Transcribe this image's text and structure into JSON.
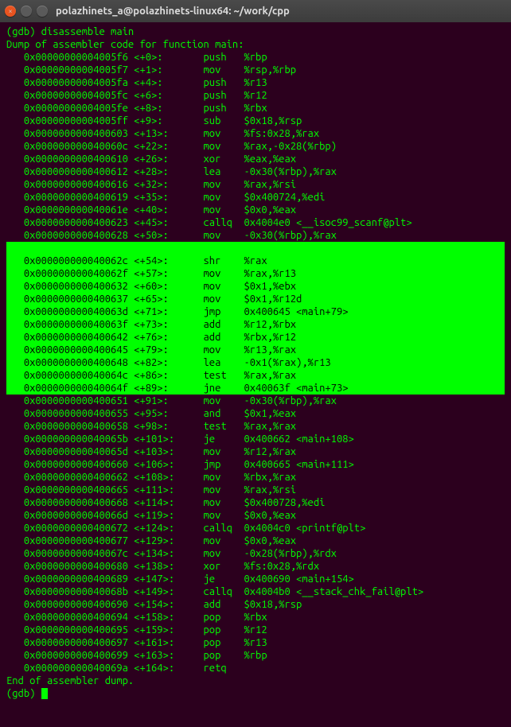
{
  "titlebar": {
    "title": "polazhinets_a@polazhinets-linux64: ~/work/cpp"
  },
  "term": {
    "prompt_cmd": "(gdb) disassemble main",
    "dump_header": "Dump of assembler code for function main:",
    "lines": [
      {
        "hl": false,
        "addr": "0x00000000004005f6",
        "off": "<+0>:",
        "mn": "push",
        "ops": "%rbp"
      },
      {
        "hl": false,
        "addr": "0x00000000004005f7",
        "off": "<+1>:",
        "mn": "mov",
        "ops": "%rsp,%rbp"
      },
      {
        "hl": false,
        "addr": "0x00000000004005fa",
        "off": "<+4>:",
        "mn": "push",
        "ops": "%r13"
      },
      {
        "hl": false,
        "addr": "0x00000000004005fc",
        "off": "<+6>:",
        "mn": "push",
        "ops": "%r12"
      },
      {
        "hl": false,
        "addr": "0x00000000004005fe",
        "off": "<+8>:",
        "mn": "push",
        "ops": "%rbx"
      },
      {
        "hl": false,
        "addr": "0x00000000004005ff",
        "off": "<+9>:",
        "mn": "sub",
        "ops": "$0x18,%rsp"
      },
      {
        "hl": false,
        "addr": "0x0000000000400603",
        "off": "<+13>:",
        "mn": "mov",
        "ops": "%fs:0x28,%rax"
      },
      {
        "hl": false,
        "addr": "0x000000000040060c",
        "off": "<+22>:",
        "mn": "mov",
        "ops": "%rax,-0x28(%rbp)"
      },
      {
        "hl": false,
        "addr": "0x0000000000400610",
        "off": "<+26>:",
        "mn": "xor",
        "ops": "%eax,%eax"
      },
      {
        "hl": false,
        "addr": "0x0000000000400612",
        "off": "<+28>:",
        "mn": "lea",
        "ops": "-0x30(%rbp),%rax"
      },
      {
        "hl": false,
        "addr": "0x0000000000400616",
        "off": "<+32>:",
        "mn": "mov",
        "ops": "%rax,%rsi"
      },
      {
        "hl": false,
        "addr": "0x0000000000400619",
        "off": "<+35>:",
        "mn": "mov",
        "ops": "$0x400724,%edi"
      },
      {
        "hl": false,
        "addr": "0x000000000040061e",
        "off": "<+40>:",
        "mn": "mov",
        "ops": "$0x0,%eax"
      },
      {
        "hl": false,
        "addr": "0x0000000000400623",
        "off": "<+45>:",
        "mn": "callq",
        "ops": "0x4004e0 <__isoc99_scanf@plt>"
      },
      {
        "hl": false,
        "addr": "0x0000000000400628",
        "off": "<+50>:",
        "mn": "mov",
        "ops": "-0x30(%rbp),%rax"
      },
      {
        "hl": true,
        "addr": "0x000000000040062c",
        "off": "<+54>:",
        "mn": "shr",
        "ops": "%rax",
        "pad": true
      },
      {
        "hl": true,
        "addr": "0x000000000040062f",
        "off": "<+57>:",
        "mn": "mov",
        "ops": "%rax,%r13"
      },
      {
        "hl": true,
        "addr": "0x0000000000400632",
        "off": "<+60>:",
        "mn": "mov",
        "ops": "$0x1,%ebx"
      },
      {
        "hl": true,
        "addr": "0x0000000000400637",
        "off": "<+65>:",
        "mn": "mov",
        "ops": "$0x1,%r12d"
      },
      {
        "hl": true,
        "addr": "0x000000000040063d",
        "off": "<+71>:",
        "mn": "jmp",
        "ops": "0x400645 <main+79>"
      },
      {
        "hl": true,
        "addr": "0x000000000040063f",
        "off": "<+73>:",
        "mn": "add",
        "ops": "%r12,%rbx"
      },
      {
        "hl": true,
        "addr": "0x0000000000400642",
        "off": "<+76>:",
        "mn": "add",
        "ops": "%rbx,%r12"
      },
      {
        "hl": true,
        "addr": "0x0000000000400645",
        "off": "<+79>:",
        "mn": "mov",
        "ops": "%r13,%rax"
      },
      {
        "hl": true,
        "addr": "0x0000000000400648",
        "off": "<+82>:",
        "mn": "lea",
        "ops": "-0x1(%rax),%r13"
      },
      {
        "hl": true,
        "addr": "0x000000000040064c",
        "off": "<+86>:",
        "mn": "test",
        "ops": "%rax,%rax"
      },
      {
        "hl": true,
        "addr": "0x000000000040064f",
        "off": "<+89>:",
        "mn": "jne",
        "ops": "0x40063f <main+73>"
      },
      {
        "hl": false,
        "addr": "0x0000000000400651",
        "off": "<+91>:",
        "mn": "mov",
        "ops": "-0x30(%rbp),%rax"
      },
      {
        "hl": false,
        "addr": "0x0000000000400655",
        "off": "<+95>:",
        "mn": "and",
        "ops": "$0x1,%eax"
      },
      {
        "hl": false,
        "addr": "0x0000000000400658",
        "off": "<+98>:",
        "mn": "test",
        "ops": "%rax,%rax"
      },
      {
        "hl": false,
        "addr": "0x000000000040065b",
        "off": "<+101>:",
        "mn": "je",
        "ops": "0x400662 <main+108>"
      },
      {
        "hl": false,
        "addr": "0x000000000040065d",
        "off": "<+103>:",
        "mn": "mov",
        "ops": "%r12,%rax"
      },
      {
        "hl": false,
        "addr": "0x0000000000400660",
        "off": "<+106>:",
        "mn": "jmp",
        "ops": "0x400665 <main+111>"
      },
      {
        "hl": false,
        "addr": "0x0000000000400662",
        "off": "<+108>:",
        "mn": "mov",
        "ops": "%rbx,%rax"
      },
      {
        "hl": false,
        "addr": "0x0000000000400665",
        "off": "<+111>:",
        "mn": "mov",
        "ops": "%rax,%rsi"
      },
      {
        "hl": false,
        "addr": "0x0000000000400668",
        "off": "<+114>:",
        "mn": "mov",
        "ops": "$0x400728,%edi"
      },
      {
        "hl": false,
        "addr": "0x000000000040066d",
        "off": "<+119>:",
        "mn": "mov",
        "ops": "$0x0,%eax"
      },
      {
        "hl": false,
        "addr": "0x0000000000400672",
        "off": "<+124>:",
        "mn": "callq",
        "ops": "0x4004c0 <printf@plt>"
      },
      {
        "hl": false,
        "addr": "0x0000000000400677",
        "off": "<+129>:",
        "mn": "mov",
        "ops": "$0x0,%eax"
      },
      {
        "hl": false,
        "addr": "0x000000000040067c",
        "off": "<+134>:",
        "mn": "mov",
        "ops": "-0x28(%rbp),%rdx"
      },
      {
        "hl": false,
        "addr": "0x0000000000400680",
        "off": "<+138>:",
        "mn": "xor",
        "ops": "%fs:0x28,%rdx"
      },
      {
        "hl": false,
        "addr": "0x0000000000400689",
        "off": "<+147>:",
        "mn": "je",
        "ops": "0x400690 <main+154>"
      },
      {
        "hl": false,
        "addr": "0x000000000040068b",
        "off": "<+149>:",
        "mn": "callq",
        "ops": "0x4004b0 <__stack_chk_fail@plt>"
      },
      {
        "hl": false,
        "addr": "0x0000000000400690",
        "off": "<+154>:",
        "mn": "add",
        "ops": "$0x18,%rsp"
      },
      {
        "hl": false,
        "addr": "0x0000000000400694",
        "off": "<+158>:",
        "mn": "pop",
        "ops": "%rbx"
      },
      {
        "hl": false,
        "addr": "0x0000000000400695",
        "off": "<+159>:",
        "mn": "pop",
        "ops": "%r12"
      },
      {
        "hl": false,
        "addr": "0x0000000000400697",
        "off": "<+161>:",
        "mn": "pop",
        "ops": "%r13"
      },
      {
        "hl": false,
        "addr": "0x0000000000400699",
        "off": "<+163>:",
        "mn": "pop",
        "ops": "%rbp"
      },
      {
        "hl": false,
        "addr": "0x000000000040069a",
        "off": "<+164>:",
        "mn": "retq",
        "ops": ""
      }
    ],
    "end_text": "End of assembler dump.",
    "prompt_end": "(gdb) "
  }
}
